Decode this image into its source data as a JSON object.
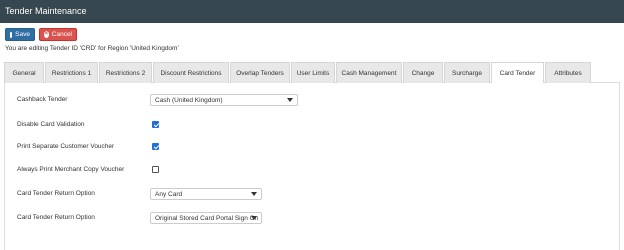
{
  "titlebar": {
    "title": "Tender Maintenance"
  },
  "toolbar": {
    "save_label": "Save",
    "cancel_label": "Cancel"
  },
  "info_text": "You are editing Tender ID 'CRD' for Region 'United Kingdom'",
  "tabs": [
    {
      "label": "General"
    },
    {
      "label": "Restrictions 1"
    },
    {
      "label": "Restrictions 2"
    },
    {
      "label": "Discount Restrictions"
    },
    {
      "label": "Overlap Tenders"
    },
    {
      "label": "User Limits"
    },
    {
      "label": "Cash Management"
    },
    {
      "label": "Change"
    },
    {
      "label": "Surcharge"
    },
    {
      "label": "Card Tender",
      "active": true
    },
    {
      "label": "Attributes"
    }
  ],
  "form": {
    "cashback_tender": {
      "label": "Cashback Tender",
      "value": "Cash (United Kingdom)"
    },
    "disable_card_validation": {
      "label": "Disable Card Validation",
      "checked": true
    },
    "print_separate_customer_voucher": {
      "label": "Print Separate Customer Voucher",
      "checked": true
    },
    "always_print_merchant_copy": {
      "label": "Always Print Merchant Copy Voucher",
      "checked": false
    },
    "return_option_1": {
      "label": "Card Tender Return Option",
      "value": "Any Card"
    },
    "return_option_2": {
      "label": "Card Tender Return Option",
      "value": "Original Stored Card Portal Sign On"
    }
  },
  "colors": {
    "titlebar": "#37474f",
    "save": "#2f6da3",
    "cancel": "#d9534f",
    "checkbox": "#1e6fd9"
  }
}
